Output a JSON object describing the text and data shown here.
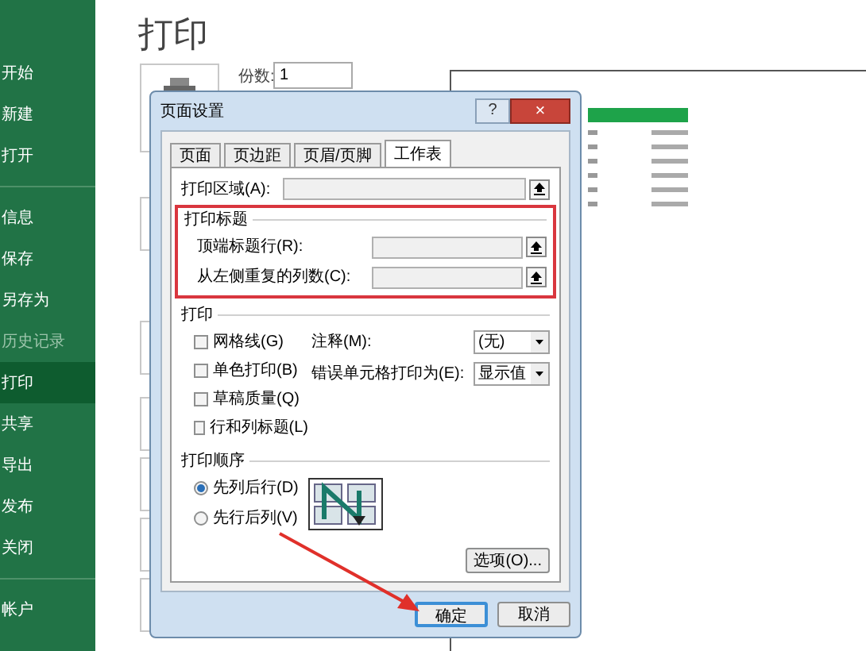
{
  "sidebar": {
    "groups": [
      [
        {
          "label": "开始",
          "selected": false,
          "disabled": false
        },
        {
          "label": "新建",
          "selected": false,
          "disabled": false
        },
        {
          "label": "打开",
          "selected": false,
          "disabled": false
        }
      ],
      [
        {
          "label": "信息",
          "selected": false,
          "disabled": false
        },
        {
          "label": "保存",
          "selected": false,
          "disabled": false
        },
        {
          "label": "另存为",
          "selected": false,
          "disabled": false
        },
        {
          "label": "历史记录",
          "selected": false,
          "disabled": true
        },
        {
          "label": "打印",
          "selected": true,
          "disabled": false
        },
        {
          "label": "共享",
          "selected": false,
          "disabled": false
        },
        {
          "label": "导出",
          "selected": false,
          "disabled": false
        },
        {
          "label": "发布",
          "selected": false,
          "disabled": false
        },
        {
          "label": "关闭",
          "selected": false,
          "disabled": false
        }
      ],
      [
        {
          "label": "帐户",
          "selected": false,
          "disabled": false
        }
      ]
    ]
  },
  "main": {
    "title": "打印",
    "copies": {
      "label": "份数:",
      "value": "1"
    }
  },
  "dialog": {
    "title": "页面设置",
    "help": "?",
    "close": "×",
    "tabs": [
      {
        "label": "页面",
        "selected": false
      },
      {
        "label": "页边距",
        "selected": false
      },
      {
        "label": "页眉/页脚",
        "selected": false
      },
      {
        "label": "工作表",
        "selected": true
      }
    ],
    "print_area": {
      "label": "打印区域(A):"
    },
    "print_titles": {
      "heading": "打印标题",
      "fields": [
        {
          "label": "顶端标题行(R):"
        },
        {
          "label": "从左侧重复的列数(C):"
        }
      ]
    },
    "print": {
      "heading": "打印",
      "checkboxes": [
        {
          "label": "网格线(G)",
          "checked": false
        },
        {
          "label": "单色打印(B)",
          "checked": false
        },
        {
          "label": "草稿质量(Q)",
          "checked": false
        },
        {
          "label": "行和列标题(L)",
          "checked": false
        }
      ],
      "selects": [
        {
          "label": "注释(M):",
          "value": "(无)"
        },
        {
          "label": "错误单元格打印为(E):",
          "value": "显示值"
        }
      ]
    },
    "order": {
      "heading": "打印顺序",
      "options": [
        {
          "label": "先列后行(D)",
          "selected": true
        },
        {
          "label": "先行后列(V)",
          "selected": false
        }
      ]
    },
    "options_button": "选项(O)...",
    "buttons": [
      {
        "label": "确定",
        "default": true
      },
      {
        "label": "取消",
        "default": false
      }
    ]
  }
}
